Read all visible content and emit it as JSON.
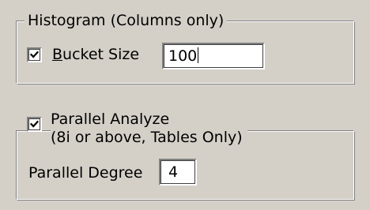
{
  "histogram": {
    "group_label": "Histogram (Columns only)",
    "bucket_size": {
      "checked": true,
      "label_accel": "B",
      "label_rest": "ucket Size",
      "value": "100"
    }
  },
  "parallel": {
    "checked": true,
    "label_line1": "Parallel Analyze",
    "label_line2": "(8i or above, Tables Only)",
    "degree": {
      "label": "Parallel Degree",
      "value": "4"
    }
  }
}
